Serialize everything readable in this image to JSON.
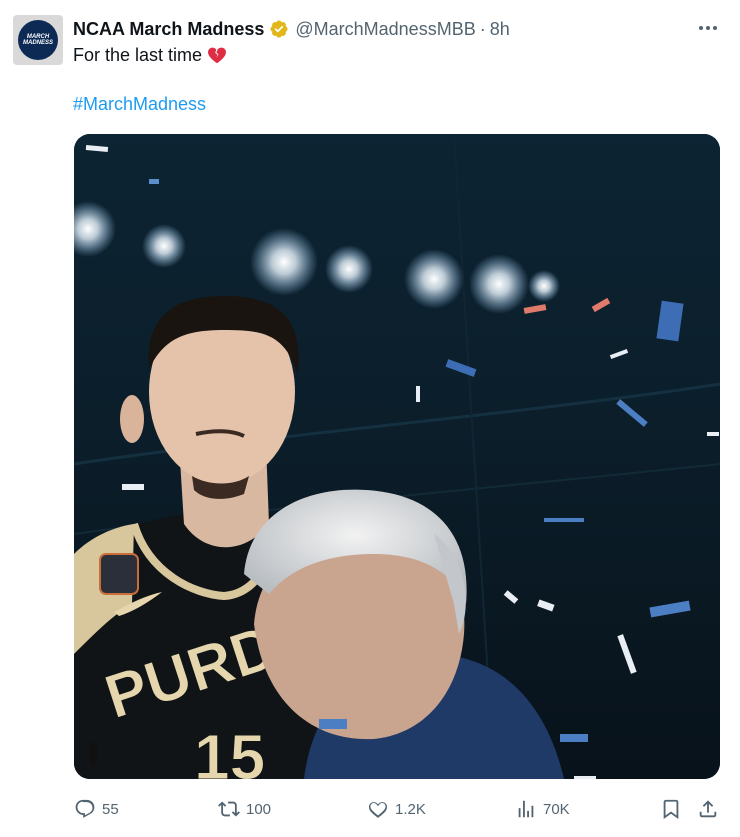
{
  "tweet": {
    "display_name": "NCAA March Madness",
    "handle": "@MarchMadnessMBB",
    "separator": "·",
    "time": "8h",
    "text": "For the last time",
    "hashtag": "#MarchMadness",
    "avatar_text_line1": "MARCH",
    "avatar_text_line2": "MADNESS",
    "verified_color": "#e2b719",
    "hashtag_color": "#1d9bf0",
    "icons": {
      "verified": "verified-badge-icon",
      "emoji": "broken-heart-icon",
      "more": "more-options-icon",
      "reply": "reply-icon",
      "retweet": "retweet-icon",
      "like": "like-icon",
      "views": "views-icon",
      "bookmark": "bookmark-icon",
      "share": "share-icon"
    }
  },
  "media": {
    "jersey_text": "PURDUE",
    "jersey_number": "15"
  },
  "actions": {
    "replies": "55",
    "retweets": "100",
    "likes": "1.2K",
    "views": "70K"
  }
}
